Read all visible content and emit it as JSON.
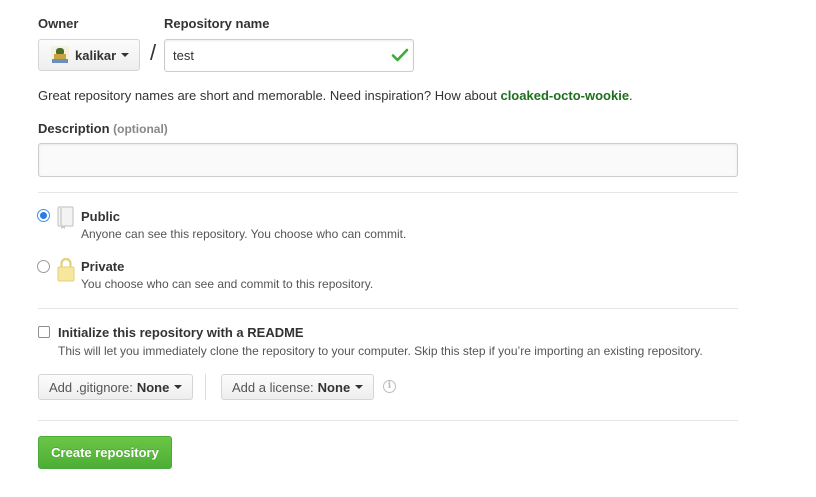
{
  "owner": {
    "label": "Owner",
    "value": "kalikar"
  },
  "repo_name": {
    "label": "Repository name",
    "value": "test",
    "separator": "/"
  },
  "name_hint": {
    "text": "Great repository names are short and memorable. Need inspiration? How about ",
    "suggestion": "cloaked-octo-wookie",
    "suffix": "."
  },
  "description": {
    "label": "Description",
    "optional": "(optional)",
    "value": ""
  },
  "visibility": {
    "public": {
      "title": "Public",
      "desc": "Anyone can see this repository. You choose who can commit.",
      "selected": true
    },
    "private": {
      "title": "Private",
      "desc": "You choose who can see and commit to this repository.",
      "selected": false
    }
  },
  "readme": {
    "title": "Initialize this repository with a README",
    "desc": "This will let you immediately clone the repository to your computer. Skip this step if you’re importing an existing repository.",
    "checked": false
  },
  "gitignore": {
    "label": "Add .gitignore:",
    "value": "None"
  },
  "license": {
    "label": "Add a license:",
    "value": "None"
  },
  "submit": {
    "label": "Create repository"
  },
  "colors": {
    "accent_green": "#6cc644",
    "suggestion_green": "#1e6e1e",
    "radio_blue": "#2a7ae2"
  }
}
